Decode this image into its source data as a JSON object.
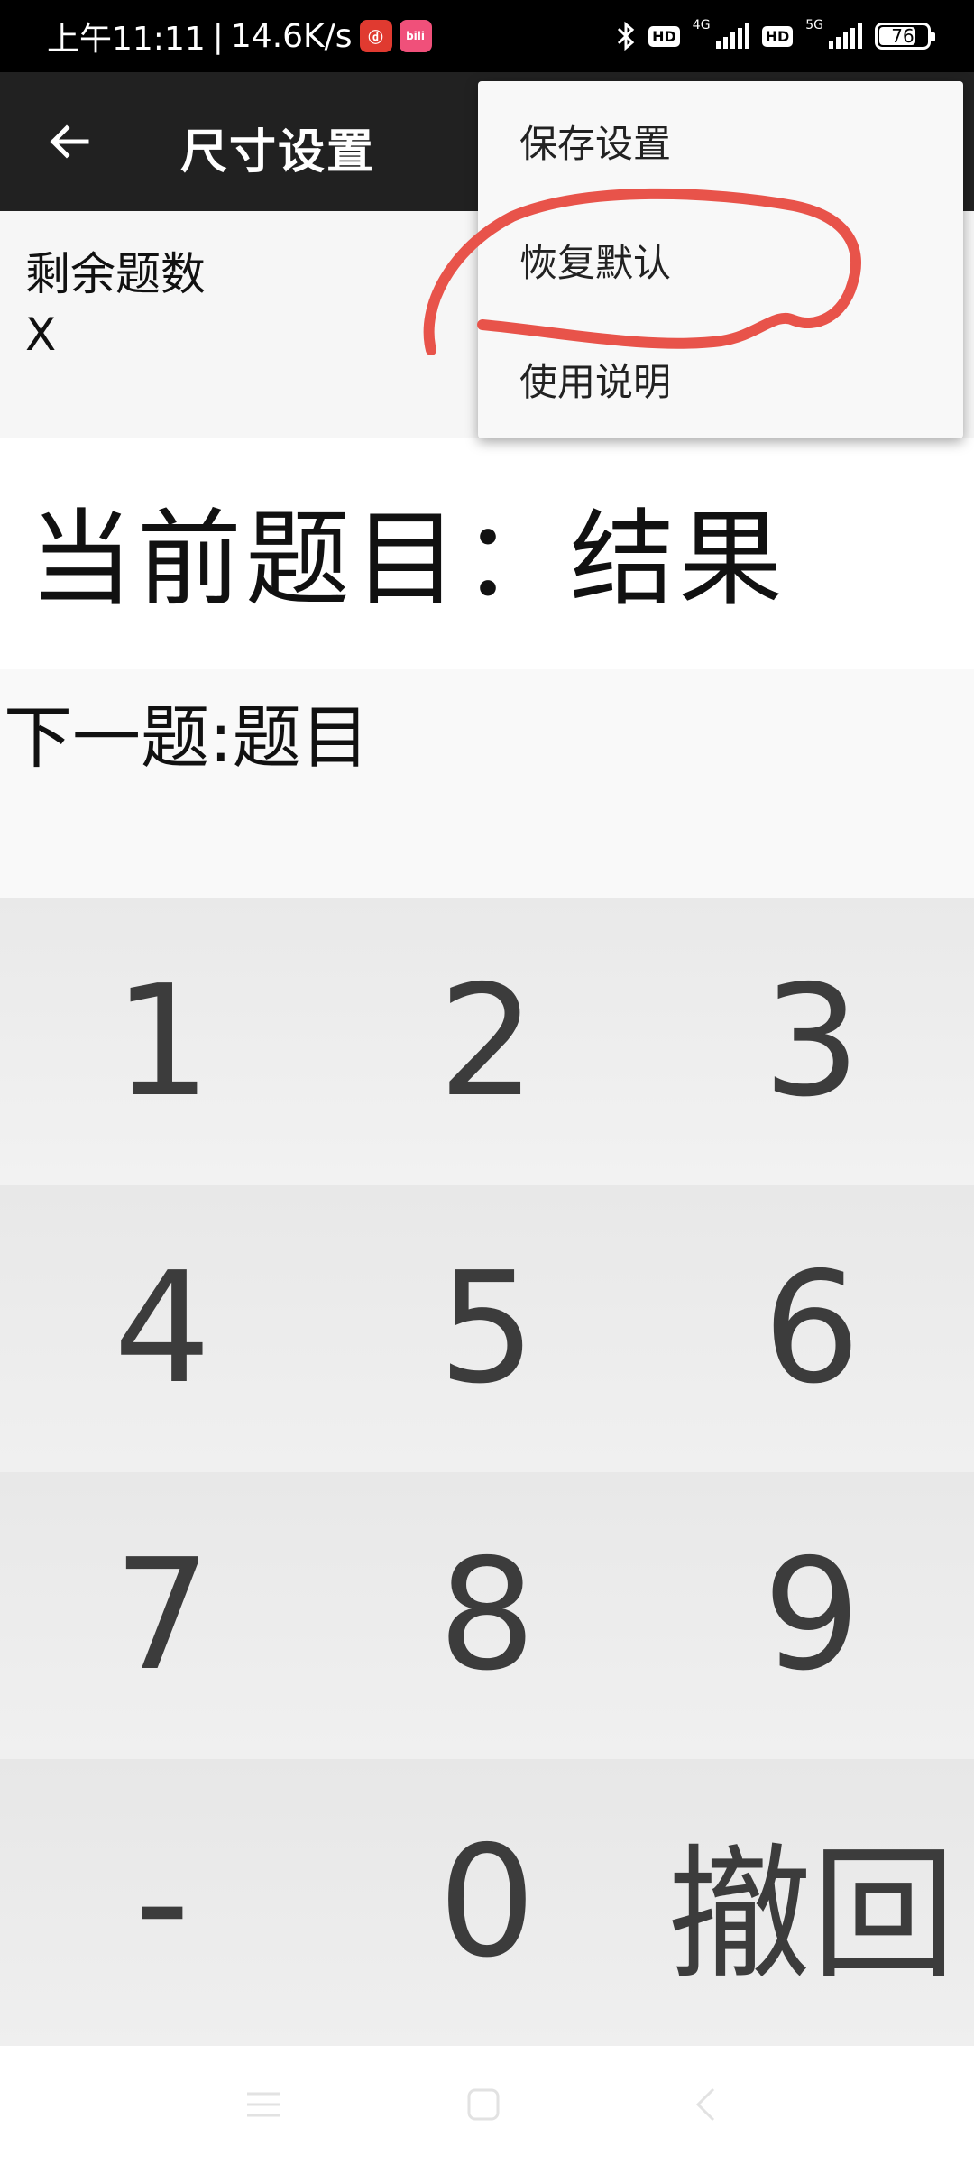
{
  "status_bar": {
    "time": "上午11:11",
    "separator": "|",
    "speed": "14.6K/s",
    "app_icons": [
      "netease-music-icon",
      "bilibili-icon"
    ],
    "netease_glyph": "ⓓ",
    "bilibili_glyph": "bili",
    "hd_label": "HD",
    "network_1": "4G",
    "network_2": "5G",
    "battery": "76"
  },
  "app_bar": {
    "back_icon": "arrow-left-icon",
    "title": "尺寸设置"
  },
  "remaining": {
    "label": "剩余题数",
    "value": "X"
  },
  "current_question": {
    "text": "当前题目：结果"
  },
  "next_question": {
    "text": "下一题:题目"
  },
  "keypad": {
    "rows": [
      [
        "1",
        "2",
        "3"
      ],
      [
        "4",
        "5",
        "6"
      ],
      [
        "7",
        "8",
        "9"
      ],
      [
        "-",
        "0",
        "撤回"
      ]
    ]
  },
  "menu": {
    "items": [
      "保存设置",
      "恢复默认",
      "使用说明"
    ],
    "highlight_color": "#e8534a"
  },
  "colors": {
    "status_bar": "#000000",
    "app_bar": "#212121",
    "key_text": "#3c3c3c"
  },
  "nav_bar": {
    "icons": [
      "menu-icon",
      "home-icon",
      "back-icon"
    ]
  }
}
